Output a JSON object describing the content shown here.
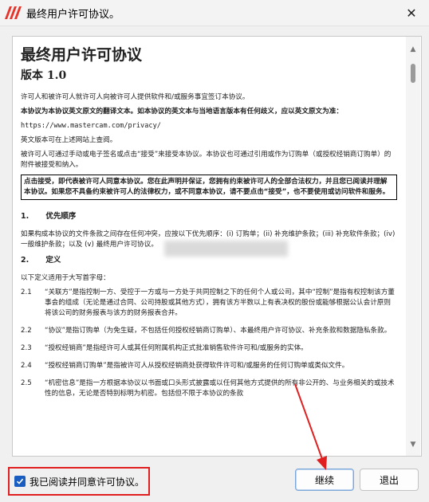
{
  "window": {
    "title": "最终用户许可协议。",
    "close_glyph": "✕"
  },
  "document": {
    "title": "最终用户许可协议",
    "version": "版本 1.0",
    "intro": "许可人和被许可人就许可人向被许可人提供软件和/或服务事宜签订本协议。",
    "translation_note": "本协议为本协议英文原文的翻译文本。如本协议的英文本与当地语言版本有任何歧义，应以英文原文为准：",
    "url": "https://www.mastercam.com/privacy/",
    "url_note": "英文版本可在上述网站上查阅。",
    "acceptance_para": "被许可人可通过手动或电子签名或点击“接受”来接受本协议。本协议也可通过引用或作为订购单（或授权经销商订购单）的附件被接受和纳入。",
    "boxed_notice": "点击接受，即代表被许可人同意本协议。您在此声明并保证，您拥有约束被许可人的全部合法权力，并且您已阅读并理解本协议。如果您不具备约束被许可人的法律权力，或不同意本协议，请不要点击“接受”，也不要使用或访问软件和服务。",
    "sections": [
      {
        "num": "1.",
        "title": "优先顺序",
        "body": "如果构成本协议的文件条款之间存在任何冲突，应按以下优先顺序：(i) 订购单；(ii) 补充维护条款；(iii) 补充软件条款；(iv) 一般维护条款；以及 (v) 最终用户许可协议。"
      },
      {
        "num": "2.",
        "title": "定义",
        "body": "以下定义适用于大写首字母："
      }
    ],
    "definitions": [
      {
        "num": "2.1",
        "text": "“关联方”是指控制一方、受控于一方或与一方处于共同控制之下的任何个人或公司，其中“控制”是指有权控制该方董事会的组成（无论是通过合同、公司持股或其他方式），拥有该方半数以上有表决权的股份或能够根据公认会计原则将该公司的财务报表与该方的财务报表合并。"
      },
      {
        "num": "2.2",
        "text": "“协议”是指订购单（为免生疑，不包括任何授权经销商订购单）、本最终用户许可协议、补充条款和数据隐私条款。"
      },
      {
        "num": "2.3",
        "text": "“授权经销商”是指经许可人或其任何附属机构正式批准销售软件许可和/或服务的实体。"
      },
      {
        "num": "2.4",
        "text": "“授权经销商订购单”是指被许可人从授权经销商处获得软件许可和/或服务的任何订购单或类似文件。"
      },
      {
        "num": "2.5",
        "text": "“机密信息”是指一方根据本协议以书面或口头形式披露或以任何其他方式提供的所有非公开的、与业务相关的或技术性的信息，无论是否特别标明为机密。包括但不限于本协议的条款"
      }
    ]
  },
  "footer": {
    "agree_label": "我已阅读并同意许可协议。",
    "agree_checked": true,
    "continue_label": "继续",
    "exit_label": "退出"
  },
  "colors": {
    "accent": "#1a5dc0",
    "annotation": "#e02020",
    "logo": "#e8332a"
  }
}
